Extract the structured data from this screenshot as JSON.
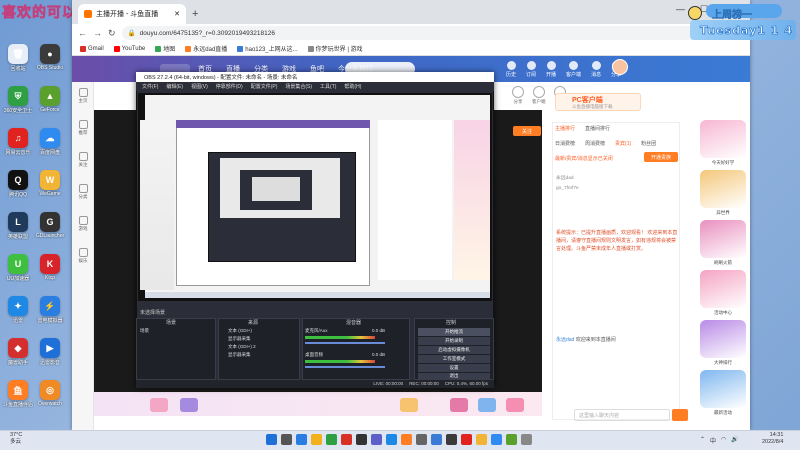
{
  "overlay": {
    "title": "喜欢的可以点点关注",
    "rank_title": "上周榜一",
    "rank_name": "Tuesday1 1 4"
  },
  "desktop_icons": [
    {
      "label": "回收站",
      "color": "#e7eef8",
      "glyph": "🗑"
    },
    {
      "label": "OBS Studio",
      "color": "#3b3b3b",
      "glyph": "●"
    },
    {
      "label": "360安全卫士",
      "color": "#2ea043",
      "glyph": "⛨"
    },
    {
      "label": "GeForce",
      "color": "#5aa02c",
      "glyph": "▲"
    },
    {
      "label": "网易云音乐",
      "color": "#e0231f",
      "glyph": "♫"
    },
    {
      "label": "百度网盘",
      "color": "#2f8bf0",
      "glyph": "☁"
    },
    {
      "label": "腾讯QQ",
      "color": "#111",
      "glyph": "Q"
    },
    {
      "label": "WeGame",
      "color": "#f1b434",
      "glyph": "W"
    },
    {
      "label": "英雄联盟",
      "color": "#1f3a5a",
      "glyph": "L"
    },
    {
      "label": "GDLauncher",
      "color": "#333",
      "glyph": "G"
    },
    {
      "label": "UU加速器",
      "color": "#3fbf3f",
      "glyph": "U"
    },
    {
      "label": "Ktcp",
      "color": "#d8232a",
      "glyph": "K"
    },
    {
      "label": "迅雷",
      "color": "#1e88e5",
      "glyph": "✦"
    },
    {
      "label": "雷电模拟器",
      "color": "#2a7de1",
      "glyph": "⚡"
    },
    {
      "label": "魔兽助手",
      "color": "#d32f2f",
      "glyph": "◆"
    },
    {
      "label": "迅雷影音",
      "color": "#1f6fd8",
      "glyph": "▶"
    },
    {
      "label": "斗鱼直播伴侣",
      "color": "#ff7d23",
      "glyph": "鱼"
    },
    {
      "label": "Overwatch",
      "color": "#f08a24",
      "glyph": "◎"
    }
  ],
  "browser": {
    "tab_title": "主播开播 - 斗鱼直播",
    "url": "douyu.com/6475135?_r=0.3092019493218126",
    "bookmarks": [
      {
        "label": "Gmail",
        "color": "#d93025"
      },
      {
        "label": "YouTube",
        "color": "#ff0000"
      },
      {
        "label": "地图",
        "color": "#34a853"
      },
      {
        "label": "永远dad直播",
        "color": "#ff7d23"
      },
      {
        "label": "hao123_上网从这...",
        "color": "#3a7bd5"
      },
      {
        "label": "你梦玩世界 | 游戏",
        "color": "#888"
      }
    ]
  },
  "douyu": {
    "nav": [
      "首页",
      "直播",
      "分类",
      "游戏",
      "鱼吧",
      "今女长期打"
    ],
    "right_nav": [
      "历史",
      "订阅",
      "开播",
      "客户端",
      "消息",
      "分享"
    ],
    "side": [
      "主页",
      "推荐",
      "关注",
      "分类",
      "游戏",
      "娱乐"
    ],
    "stream_top": [
      "分享",
      "客户端",
      "更多"
    ],
    "pc_live_label": "PC客户端",
    "pc_live_sub": "斗鱼直播电脑版下载",
    "follow": "关注",
    "chat_tabs": [
      "主播排行",
      "直播间排行"
    ],
    "chat_tabs2": [
      "日消费榜",
      "周消费榜",
      "贵宾(1)",
      "粉丝团"
    ],
    "guard_text": "最新/贵宾/消息显示已关闭",
    "open_guard": "开通贵族",
    "chat_lines": [
      "永远dad",
      "go_7fmf7e"
    ],
    "sys_msg": "系统提示：已提升直播画质，欢迎观看！ 欢迎来到本直播间，请遵守直播间规则文明发言，如有违规将会被禁言处理。斗鱼严禁未成年人直播或打赏。",
    "welcome_user": "永远dad",
    "welcome_text": "欢迎来到本直播间",
    "chat_placeholder": "这里输入聊天内容",
    "deco": [
      "今天好好学",
      "异世界",
      "刷刷火箭",
      "活动中心",
      "大神排行",
      "最新活动"
    ]
  },
  "obs": {
    "title": "OBS 27.2.4 (64-bit, windows) - 配置文件: 未命名 - 场景: 未命名",
    "menu": [
      "文件(F)",
      "编辑(E)",
      "视图(V)",
      "停靠部件(D)",
      "配置文件(P)",
      "场景集合(S)",
      "工具(T)",
      "帮助(H)"
    ],
    "panels": {
      "scenes": "场景",
      "sources": "来源",
      "mixer": "混音器",
      "controls": "控制"
    },
    "scene_item": "场景",
    "sources_items": [
      "文本 (GDI+)",
      "显示器采集",
      "文本 (GDI+) 2",
      "显示器采集"
    ],
    "mixer_items": [
      "麦克风/Aux",
      "桌面音频"
    ],
    "mixer_db": [
      "0.0 dB",
      "0.0 dB"
    ],
    "controls": [
      "开始推流",
      "开始录制",
      "启动虚拟摄像机",
      "工作室模式",
      "设置",
      "退出"
    ],
    "status": [
      "LIVE: 00:00:00",
      "REC: 00:00:00",
      "CPU: 0.4%, 60.00 fps"
    ],
    "transition": "未选择场景"
  },
  "taskbar": {
    "weather_temp": "37°C",
    "weather_desc": "多云",
    "time": "14:31",
    "date": "2022/8/4",
    "lang": "中"
  }
}
